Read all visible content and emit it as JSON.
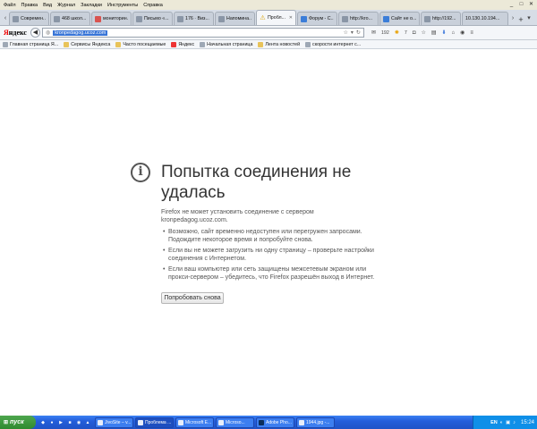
{
  "menu": [
    "Файл",
    "Правка",
    "Вид",
    "Журнал",
    "Закладки",
    "Инструменты",
    "Справка"
  ],
  "window_controls": [
    "_",
    "□",
    "✕"
  ],
  "tabs": [
    {
      "label": "Современ...",
      "icon": "page-icon",
      "active": false
    },
    {
      "label": "468 школ...",
      "icon": "page-icon",
      "active": false
    },
    {
      "label": "мониторин...",
      "icon": "page-icon",
      "active": false
    },
    {
      "label": "Письмо «...",
      "icon": "page-icon",
      "active": false
    },
    {
      "label": "176 · Виз...",
      "icon": "page-icon",
      "active": false
    },
    {
      "label": "Напомина...",
      "icon": "page-icon",
      "active": false
    },
    {
      "label": "Пробл...",
      "icon": "warning-icon",
      "active": true
    },
    {
      "label": "Форум - С...",
      "icon": "page-icon",
      "active": false
    },
    {
      "label": "http://kro...",
      "icon": "page-icon",
      "active": false
    },
    {
      "label": "Сайт не о...",
      "icon": "page-icon",
      "active": false
    },
    {
      "label": "http://192...",
      "icon": "page-icon",
      "active": false
    },
    {
      "label": "10.130.10.194...",
      "icon": "page-icon",
      "active": false
    }
  ],
  "nav": {
    "logo": "Яндекс",
    "url": "kronpedagog.ucoz.com",
    "count_a": "192",
    "count_b": "7"
  },
  "bookmarks": [
    "Главная страница Я...",
    "Сервисы Яндекса",
    "Часто посещаемые",
    "Яндекс",
    "Начальная страница",
    "Лента новостей",
    "скорости интернет с..."
  ],
  "error": {
    "title": "Попытка соединения не удалась",
    "description": "Firefox не может установить соединение с сервером kronpedagog.ucoz.com.",
    "items": [
      "Возможно, сайт временно недоступен или перегружен запросами. Подождите некоторое время и попробуйте снова.",
      "Если вы не можете загрузить ни одну страницу – проверьте настройки соединения с Интернетом.",
      "Если ваш компьютер или сеть защищены межсетевым экраном или прокси-сервером – убедитесь, что Firefox разрешён выход в Интернет."
    ],
    "retry_label": "Попробовать снова"
  },
  "taskbar": {
    "start_label": "пуск",
    "tasks": [
      {
        "label": "JivoSite – v...",
        "active": false
      },
      {
        "label": "Проблема ...",
        "active": true
      },
      {
        "label": "Microsoft E...",
        "active": false
      },
      {
        "label": "Microso...",
        "active": false
      },
      {
        "label": "Adobe Pho...",
        "active": false
      },
      {
        "label": "1944.jpg -...",
        "active": false
      }
    ],
    "lang": "EN",
    "clock": "15:24"
  }
}
